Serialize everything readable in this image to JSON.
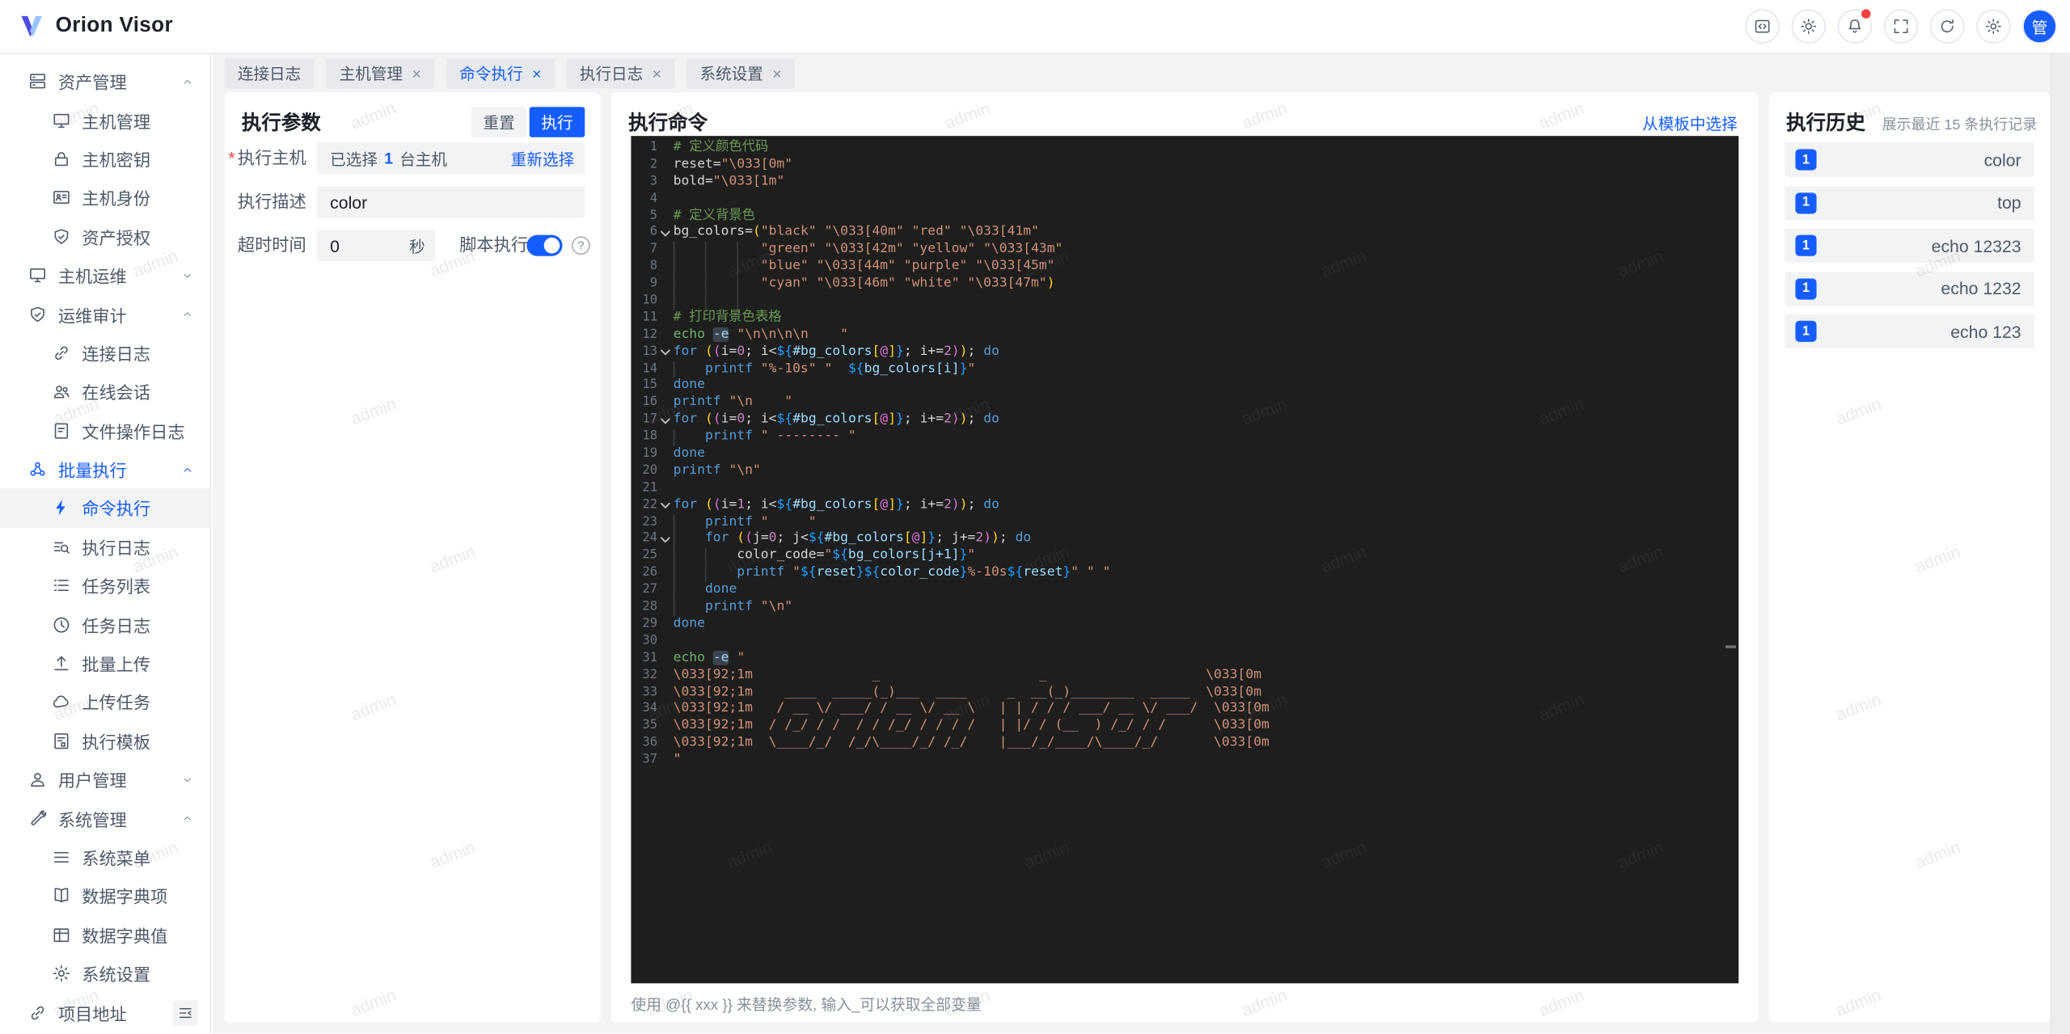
{
  "brand": {
    "name": "Orion Visor"
  },
  "topbar": {
    "buttons": [
      {
        "icon": "code-icon"
      },
      {
        "icon": "theme-icon"
      },
      {
        "icon": "bell-icon",
        "dot": true
      },
      {
        "icon": "fullscreen-icon"
      },
      {
        "icon": "refresh-icon"
      },
      {
        "icon": "settings-icon"
      }
    ],
    "avatar_text": "管"
  },
  "tabs": [
    {
      "label": "连接日志",
      "closable": false,
      "active": false
    },
    {
      "label": "主机管理",
      "closable": true,
      "active": false
    },
    {
      "label": "命令执行",
      "closable": true,
      "active": true
    },
    {
      "label": "执行日志",
      "closable": true,
      "active": false
    },
    {
      "label": "系统设置",
      "closable": true,
      "active": false
    }
  ],
  "sidebar": {
    "items": [
      {
        "label": "资产管理",
        "icon": "server-icon",
        "level": 0,
        "chevron": "up"
      },
      {
        "label": "主机管理",
        "icon": "monitor-icon",
        "level": 1
      },
      {
        "label": "主机密钥",
        "icon": "lock-icon",
        "level": 1
      },
      {
        "label": "主机身份",
        "icon": "idcard-icon",
        "level": 1
      },
      {
        "label": "资产授权",
        "icon": "shield-icon",
        "level": 1
      },
      {
        "label": "主机运维",
        "icon": "monitor-icon",
        "level": 0,
        "chevron": "down"
      },
      {
        "label": "运维审计",
        "icon": "shield-icon",
        "level": 0,
        "chevron": "up"
      },
      {
        "label": "连接日志",
        "icon": "link-icon",
        "level": 1
      },
      {
        "label": "在线会话",
        "icon": "users-icon",
        "level": 1
      },
      {
        "label": "文件操作日志",
        "icon": "document-icon",
        "level": 1
      },
      {
        "label": "批量执行",
        "icon": "cluster-icon",
        "level": 0,
        "chevron": "up",
        "accent": true
      },
      {
        "label": "命令执行",
        "icon": "bolt-icon",
        "level": 1,
        "active": true
      },
      {
        "label": "执行日志",
        "icon": "search-list-icon",
        "level": 1
      },
      {
        "label": "任务列表",
        "icon": "list-icon",
        "level": 1
      },
      {
        "label": "任务日志",
        "icon": "clock-icon",
        "level": 1
      },
      {
        "label": "批量上传",
        "icon": "upload-icon",
        "level": 1
      },
      {
        "label": "上传任务",
        "icon": "cloud-icon",
        "level": 1
      },
      {
        "label": "执行模板",
        "icon": "template-icon",
        "level": 1
      },
      {
        "label": "用户管理",
        "icon": "user-icon",
        "level": 0,
        "chevron": "down"
      },
      {
        "label": "系统管理",
        "icon": "wrench-icon",
        "level": 0,
        "chevron": "up"
      },
      {
        "label": "系统菜单",
        "icon": "menu-icon",
        "level": 1
      },
      {
        "label": "数据字典项",
        "icon": "book-icon",
        "level": 1
      },
      {
        "label": "数据字典值",
        "icon": "table-icon",
        "level": 1
      },
      {
        "label": "系统设置",
        "icon": "gear-icon",
        "level": 1
      },
      {
        "label": "项目地址",
        "icon": "external-link-icon",
        "level": 0
      }
    ]
  },
  "params": {
    "title": "执行参数",
    "reset_label": "重置",
    "run_label": "执行",
    "host_label": "执行主机",
    "host_selected_prefix": "已选择",
    "host_count": "1",
    "host_selected_suffix": "台主机",
    "host_action": "重新选择",
    "desc_label": "执行描述",
    "desc_value": "color",
    "timeout_label": "超时时间",
    "timeout_value": "0",
    "timeout_unit": "秒",
    "script_label": "脚本执行",
    "script_enabled": true,
    "help_glyph": "?"
  },
  "command": {
    "title": "执行命令",
    "template_link": "从模板中选择",
    "hint": "使用 @{{ xxx }} 来替换参数, 输入_可以获取全部变量"
  },
  "editor": {
    "lines": [
      {
        "n": 1,
        "i": 0,
        "f": false,
        "s": [
          [
            "cm",
            "# 定义颜色代码"
          ]
        ]
      },
      {
        "n": 2,
        "i": 0,
        "f": false,
        "s": [
          [
            "df",
            "reset="
          ],
          [
            "st",
            "\"\\033[0m\""
          ]
        ]
      },
      {
        "n": 3,
        "i": 0,
        "f": false,
        "s": [
          [
            "df",
            "bold="
          ],
          [
            "st",
            "\"\\033[1m\""
          ]
        ]
      },
      {
        "n": 4,
        "i": 0,
        "f": false,
        "s": []
      },
      {
        "n": 5,
        "i": 0,
        "f": false,
        "s": [
          [
            "cm",
            "# 定义背景色"
          ]
        ]
      },
      {
        "n": 6,
        "i": 0,
        "f": true,
        "s": [
          [
            "df",
            "bg_colors="
          ],
          [
            "p1",
            "("
          ],
          [
            "st",
            "\"black\""
          ],
          [
            "df",
            " "
          ],
          [
            "st",
            "\"\\033[40m\""
          ],
          [
            "df",
            " "
          ],
          [
            "st",
            "\"red\""
          ],
          [
            "df",
            " "
          ],
          [
            "st",
            "\"\\033[41m\""
          ]
        ]
      },
      {
        "n": 7,
        "i": 11,
        "f": false,
        "s": [
          [
            "st",
            "\"green\""
          ],
          [
            "df",
            " "
          ],
          [
            "st",
            "\"\\033[42m\""
          ],
          [
            "df",
            " "
          ],
          [
            "st",
            "\"yellow\""
          ],
          [
            "df",
            " "
          ],
          [
            "st",
            "\"\\033[43m\""
          ]
        ]
      },
      {
        "n": 8,
        "i": 11,
        "f": false,
        "s": [
          [
            "st",
            "\"blue\""
          ],
          [
            "df",
            " "
          ],
          [
            "st",
            "\"\\033[44m\""
          ],
          [
            "df",
            " "
          ],
          [
            "st",
            "\"purple\""
          ],
          [
            "df",
            " "
          ],
          [
            "st",
            "\"\\033[45m\""
          ]
        ]
      },
      {
        "n": 9,
        "i": 11,
        "f": false,
        "s": [
          [
            "st",
            "\"cyan\""
          ],
          [
            "df",
            " "
          ],
          [
            "st",
            "\"\\033[46m\""
          ],
          [
            "df",
            " "
          ],
          [
            "st",
            "\"white\""
          ],
          [
            "df",
            " "
          ],
          [
            "st",
            "\"\\033[47m\""
          ],
          [
            "p1",
            ")"
          ]
        ]
      },
      {
        "n": 10,
        "i": 11,
        "f": false,
        "s": []
      },
      {
        "n": 11,
        "i": 0,
        "f": false,
        "s": [
          [
            "cm",
            "# 打印背景色表格"
          ]
        ]
      },
      {
        "n": 12,
        "i": 0,
        "f": false,
        "s": [
          [
            "fn",
            "echo"
          ],
          [
            "df",
            " "
          ],
          [
            "hl",
            "-e"
          ],
          [
            "df",
            " "
          ],
          [
            "st",
            "\"\\n\\n\\n\\n    \""
          ]
        ]
      },
      {
        "n": 13,
        "i": 0,
        "f": true,
        "s": [
          [
            "kw",
            "for"
          ],
          [
            "df",
            " "
          ],
          [
            "p1",
            "("
          ],
          [
            "p2",
            "("
          ],
          [
            "df",
            "i="
          ],
          [
            "num",
            "0"
          ],
          [
            "df",
            "; i<"
          ],
          [
            "p3",
            "${"
          ],
          [
            "vr",
            "#bg_colors"
          ],
          [
            "p1",
            "["
          ],
          [
            "p2",
            "@"
          ],
          [
            "p1",
            "]"
          ],
          [
            "p3",
            "}"
          ],
          [
            "df",
            "; i+="
          ],
          [
            "num",
            "2"
          ],
          [
            "p2",
            ")"
          ],
          [
            "p1",
            ")"
          ],
          [
            "df",
            "; "
          ],
          [
            "kw",
            "do"
          ]
        ]
      },
      {
        "n": 14,
        "i": 4,
        "f": false,
        "s": [
          [
            "kw",
            "printf"
          ],
          [
            "df",
            " "
          ],
          [
            "st",
            "\"%-10s\""
          ],
          [
            "df",
            " "
          ],
          [
            "st",
            "\"  "
          ],
          [
            "p3",
            "${"
          ],
          [
            "vr",
            "bg_colors[i]"
          ],
          [
            "p3",
            "}"
          ],
          [
            "st",
            "\""
          ]
        ]
      },
      {
        "n": 15,
        "i": 0,
        "f": false,
        "s": [
          [
            "kw",
            "done"
          ]
        ]
      },
      {
        "n": 16,
        "i": 0,
        "f": false,
        "s": [
          [
            "kw",
            "printf"
          ],
          [
            "df",
            " "
          ],
          [
            "st",
            "\"\\n    \""
          ]
        ]
      },
      {
        "n": 17,
        "i": 0,
        "f": true,
        "s": [
          [
            "kw",
            "for"
          ],
          [
            "df",
            " "
          ],
          [
            "p1",
            "("
          ],
          [
            "p2",
            "("
          ],
          [
            "df",
            "i="
          ],
          [
            "num",
            "0"
          ],
          [
            "df",
            "; i<"
          ],
          [
            "p3",
            "${"
          ],
          [
            "vr",
            "#bg_colors"
          ],
          [
            "p1",
            "["
          ],
          [
            "p2",
            "@"
          ],
          [
            "p1",
            "]"
          ],
          [
            "p3",
            "}"
          ],
          [
            "df",
            "; i+="
          ],
          [
            "num",
            "2"
          ],
          [
            "p2",
            ")"
          ],
          [
            "p1",
            ")"
          ],
          [
            "df",
            "; "
          ],
          [
            "kw",
            "do"
          ]
        ]
      },
      {
        "n": 18,
        "i": 4,
        "f": false,
        "s": [
          [
            "kw",
            "printf"
          ],
          [
            "df",
            " "
          ],
          [
            "st",
            "\" -------- \""
          ]
        ]
      },
      {
        "n": 19,
        "i": 0,
        "f": false,
        "s": [
          [
            "kw",
            "done"
          ]
        ]
      },
      {
        "n": 20,
        "i": 0,
        "f": false,
        "s": [
          [
            "kw",
            "printf"
          ],
          [
            "df",
            " "
          ],
          [
            "st",
            "\"\\n\""
          ]
        ]
      },
      {
        "n": 21,
        "i": 0,
        "f": false,
        "s": []
      },
      {
        "n": 22,
        "i": 0,
        "f": true,
        "s": [
          [
            "kw",
            "for"
          ],
          [
            "df",
            " "
          ],
          [
            "p1",
            "("
          ],
          [
            "p2",
            "("
          ],
          [
            "df",
            "i="
          ],
          [
            "num",
            "1"
          ],
          [
            "df",
            "; i<"
          ],
          [
            "p3",
            "${"
          ],
          [
            "vr",
            "#bg_colors"
          ],
          [
            "p1",
            "["
          ],
          [
            "p2",
            "@"
          ],
          [
            "p1",
            "]"
          ],
          [
            "p3",
            "}"
          ],
          [
            "df",
            "; i+="
          ],
          [
            "num",
            "2"
          ],
          [
            "p2",
            ")"
          ],
          [
            "p1",
            ")"
          ],
          [
            "df",
            "; "
          ],
          [
            "kw",
            "do"
          ]
        ]
      },
      {
        "n": 23,
        "i": 4,
        "f": false,
        "s": [
          [
            "kw",
            "printf"
          ],
          [
            "df",
            " "
          ],
          [
            "st",
            "\"     \""
          ]
        ]
      },
      {
        "n": 24,
        "i": 4,
        "f": true,
        "s": [
          [
            "kw",
            "for"
          ],
          [
            "df",
            " "
          ],
          [
            "p1",
            "("
          ],
          [
            "p2",
            "("
          ],
          [
            "df",
            "j="
          ],
          [
            "num",
            "0"
          ],
          [
            "df",
            "; j<"
          ],
          [
            "p3",
            "${"
          ],
          [
            "vr",
            "#bg_colors"
          ],
          [
            "p1",
            "["
          ],
          [
            "p2",
            "@"
          ],
          [
            "p1",
            "]"
          ],
          [
            "p3",
            "}"
          ],
          [
            "df",
            "; j+="
          ],
          [
            "num",
            "2"
          ],
          [
            "p2",
            ")"
          ],
          [
            "p1",
            ")"
          ],
          [
            "df",
            "; "
          ],
          [
            "kw",
            "do"
          ]
        ]
      },
      {
        "n": 25,
        "i": 8,
        "f": false,
        "s": [
          [
            "df",
            "color_code="
          ],
          [
            "st",
            "\""
          ],
          [
            "p3",
            "${"
          ],
          [
            "vr",
            "bg_colors[j+1]"
          ],
          [
            "p3",
            "}"
          ],
          [
            "st",
            "\""
          ]
        ]
      },
      {
        "n": 26,
        "i": 8,
        "f": false,
        "s": [
          [
            "kw",
            "printf"
          ],
          [
            "df",
            " "
          ],
          [
            "st",
            "\""
          ],
          [
            "p3",
            "${"
          ],
          [
            "vr",
            "reset"
          ],
          [
            "p3",
            "}"
          ],
          [
            "p3",
            "${"
          ],
          [
            "vr",
            "color_code"
          ],
          [
            "p3",
            "}"
          ],
          [
            "st",
            "%-10s"
          ],
          [
            "p3",
            "${"
          ],
          [
            "vr",
            "reset"
          ],
          [
            "p3",
            "}"
          ],
          [
            "st",
            "\""
          ],
          [
            "df",
            " "
          ],
          [
            "st",
            "\" \""
          ]
        ]
      },
      {
        "n": 27,
        "i": 4,
        "f": false,
        "s": [
          [
            "kw",
            "done"
          ]
        ]
      },
      {
        "n": 28,
        "i": 4,
        "f": false,
        "s": [
          [
            "kw",
            "printf"
          ],
          [
            "df",
            " "
          ],
          [
            "st",
            "\"\\n\""
          ]
        ]
      },
      {
        "n": 29,
        "i": 0,
        "f": false,
        "s": [
          [
            "kw",
            "done"
          ]
        ]
      },
      {
        "n": 30,
        "i": 0,
        "f": false,
        "s": []
      },
      {
        "n": 31,
        "i": 0,
        "f": false,
        "s": [
          [
            "fn",
            "echo"
          ],
          [
            "df",
            " "
          ],
          [
            "hl",
            "-e"
          ],
          [
            "df",
            " "
          ],
          [
            "st",
            "\""
          ]
        ]
      },
      {
        "n": 32,
        "i": 0,
        "f": false,
        "s": [
          [
            "st",
            "\\033[92;1m               _                    _                    \\033[0m"
          ]
        ]
      },
      {
        "n": 33,
        "i": 0,
        "f": false,
        "s": [
          [
            "st",
            "\\033[92;1m    ____  _____(_)___  ____     _  __(_)________  _____  \\033[0m"
          ]
        ]
      },
      {
        "n": 34,
        "i": 0,
        "f": false,
        "s": [
          [
            "st",
            "\\033[92;1m   / __ \\/ ___/ / __ \\/ __ \\   | | / / / ___/ __ \\/ ___/  \\033[0m"
          ]
        ]
      },
      {
        "n": 35,
        "i": 0,
        "f": false,
        "s": [
          [
            "st",
            "\\033[92;1m  / /_/ / /  / / /_/ / / / /   | |/ / (__  ) /_/ / /      \\033[0m"
          ]
        ]
      },
      {
        "n": 36,
        "i": 0,
        "f": false,
        "s": [
          [
            "st",
            "\\033[92;1m  \\____/_/  /_/\\____/_/ /_/    |___/_/____/\\____/_/       \\033[0m"
          ]
        ]
      },
      {
        "n": 37,
        "i": 0,
        "f": false,
        "s": [
          [
            "st",
            "\""
          ]
        ]
      }
    ]
  },
  "history": {
    "title": "执行历史",
    "subtitle": "展示最近 15 条执行记录",
    "items": [
      {
        "badge": "1",
        "command": "color"
      },
      {
        "badge": "1",
        "command": "top"
      },
      {
        "badge": "1",
        "command": "echo 12323"
      },
      {
        "badge": "1",
        "command": "echo 1232"
      },
      {
        "badge": "1",
        "command": "echo 123"
      }
    ]
  },
  "watermark": {
    "text": "admin"
  },
  "colors": {
    "accent": "#165DFF",
    "danger": "#F53F3F",
    "editor_bg": "#1E1E1E",
    "comment": "#6A9955",
    "string": "#CE9178",
    "keyword": "#569CD6",
    "builtin": "#6DB26D",
    "variable": "#9CDCFE",
    "number": "#C586C0",
    "bracket_gold": "#FFD700",
    "bracket_pink": "#DA70D6",
    "bracket_blue": "#179FFF"
  }
}
